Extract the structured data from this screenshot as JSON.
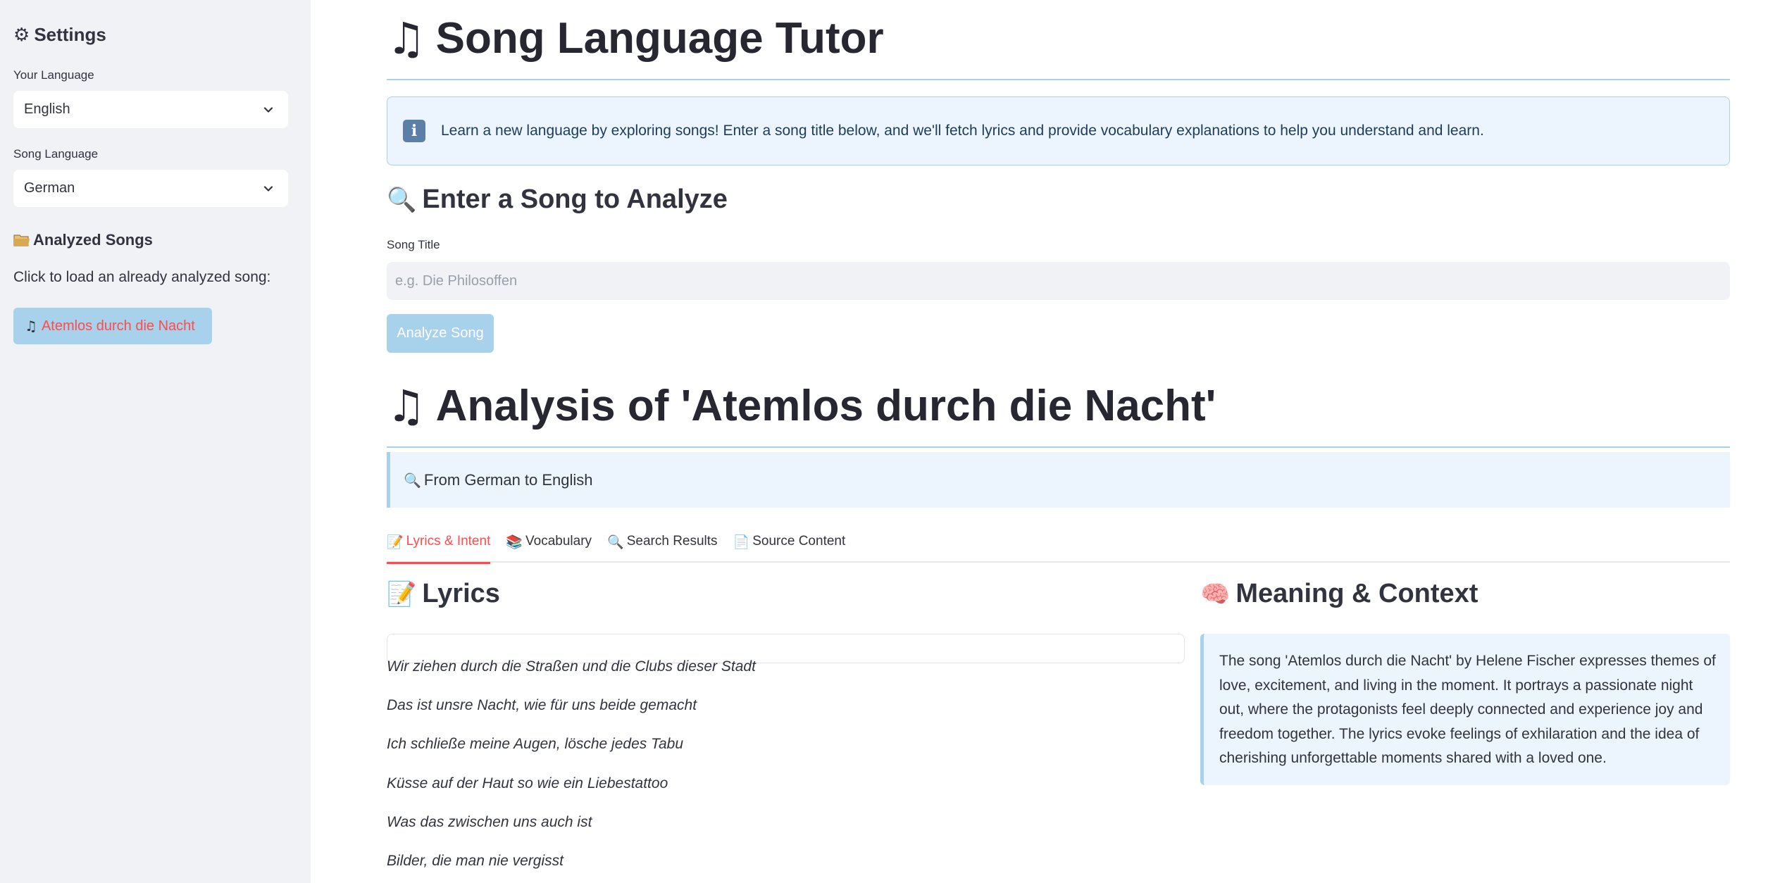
{
  "sidebar": {
    "title_icon": "gear-icon",
    "title": "Settings",
    "your_language_label": "Your Language",
    "your_language_value": "English",
    "song_language_label": "Song Language",
    "song_language_value": "German",
    "analyzed_heading_icon": "folder-icon",
    "analyzed_heading": "Analyzed Songs",
    "analyzed_hint": "Click to load an already analyzed song:",
    "songs": [
      {
        "icon": "music-note-icon",
        "label": "Atemlos durch die Nacht"
      }
    ]
  },
  "main": {
    "title_icon": "music-note-icon",
    "title": "Song Language Tutor",
    "info_icon": "info-icon",
    "info_text": "Learn a new language by exploring songs! Enter a song title below, and we'll fetch lyrics and provide vocabulary explanations to help you understand and learn.",
    "enter_heading_icon": "magnifier-icon",
    "enter_heading": "Enter a Song to Analyze",
    "song_title_label": "Song Title",
    "song_title_value": "",
    "song_title_placeholder": "e.g. Die Philosoffen",
    "analyze_button": "Analyze Song",
    "analysis_title_icon": "music-note-icon",
    "analysis_title": "Analysis of 'Atemlos durch die Nacht'",
    "from_to_icon": "magnifier-icon",
    "from_to": "From German to English",
    "tabs": [
      {
        "icon": "memo-icon",
        "label": "Lyrics & Intent",
        "active": true
      },
      {
        "icon": "books-icon",
        "label": "Vocabulary",
        "active": false
      },
      {
        "icon": "magnifier-icon",
        "label": "Search Results",
        "active": false
      },
      {
        "icon": "page-icon",
        "label": "Source Content",
        "active": false
      }
    ],
    "lyrics_heading_icon": "memo-icon",
    "lyrics_heading": "Lyrics",
    "lyrics": [
      "Wir ziehen durch die Straßen und die Clubs dieser Stadt",
      "Das ist unsre Nacht, wie für uns beide gemacht",
      "Ich schließe meine Augen, lösche jedes Tabu",
      "Küsse auf der Haut so wie ein Liebestattoo",
      "Was das zwischen uns auch ist",
      "Bilder, die man nie vergisst"
    ],
    "meaning_heading_icon": "brain-icon",
    "meaning_heading": "Meaning & Context",
    "meaning_text": "The song 'Atemlos durch die Nacht' by Helene Fischer expresses themes of love, excitement, and living in the moment. It portrays a passionate night out, where the protagonists feel deeply connected and experience joy and freedom together. The lyrics evoke feelings of exhilaration and the idea of cherishing unforgettable moments shared with a loved one."
  },
  "colors": {
    "accent": "#ff4b4b",
    "sidebar_bg": "#f0f2f6",
    "info_bg": "#ecf5fd",
    "info_border": "#a8d1eb"
  }
}
